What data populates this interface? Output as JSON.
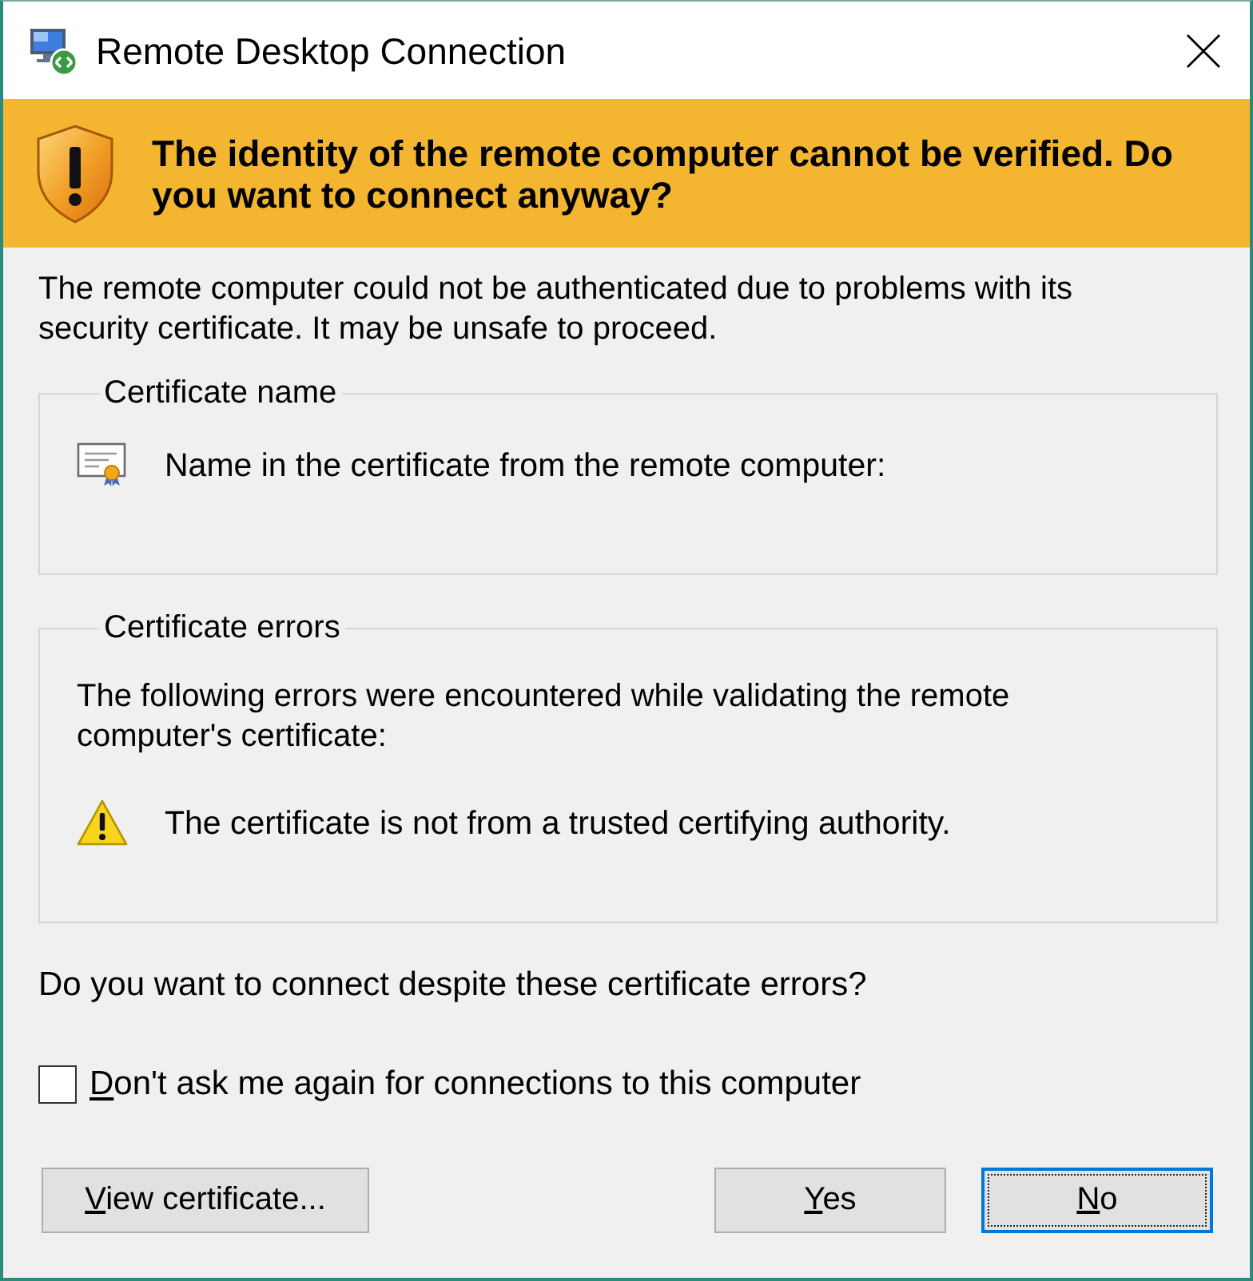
{
  "window": {
    "title": "Remote Desktop Connection"
  },
  "banner": {
    "message": "The identity of the remote computer cannot be verified. Do you want to connect anyway?"
  },
  "intro": "The remote computer could not be authenticated due to problems with its security certificate. It may be unsafe to proceed.",
  "groups": [
    {
      "kind": "name",
      "title": "Certificate name",
      "items": [
        {
          "kind": "certificate",
          "text": "Name in the certificate from the remote computer:"
        }
      ]
    },
    {
      "kind": "errors",
      "title": "Certificate errors",
      "description": "The following errors were encountered while validating the remote computer's certificate:",
      "items": [
        {
          "kind": "warning",
          "text": "The certificate is not from a trusted certifying authority."
        }
      ]
    }
  ],
  "question": "Do you want to connect despite these certificate errors?",
  "checkbox": {
    "label": "Don't ask me again for connections to this computer",
    "checked": false,
    "access_key_underlined": true
  },
  "button_bar": {
    "left": [
      {
        "label": "View certificate...",
        "default": false,
        "access_key_underlined": true
      }
    ],
    "right": [
      {
        "label": "Yes",
        "default": false,
        "access_key_underlined": true
      },
      {
        "label": "No",
        "default": true,
        "access_key_underlined": true
      }
    ]
  }
}
